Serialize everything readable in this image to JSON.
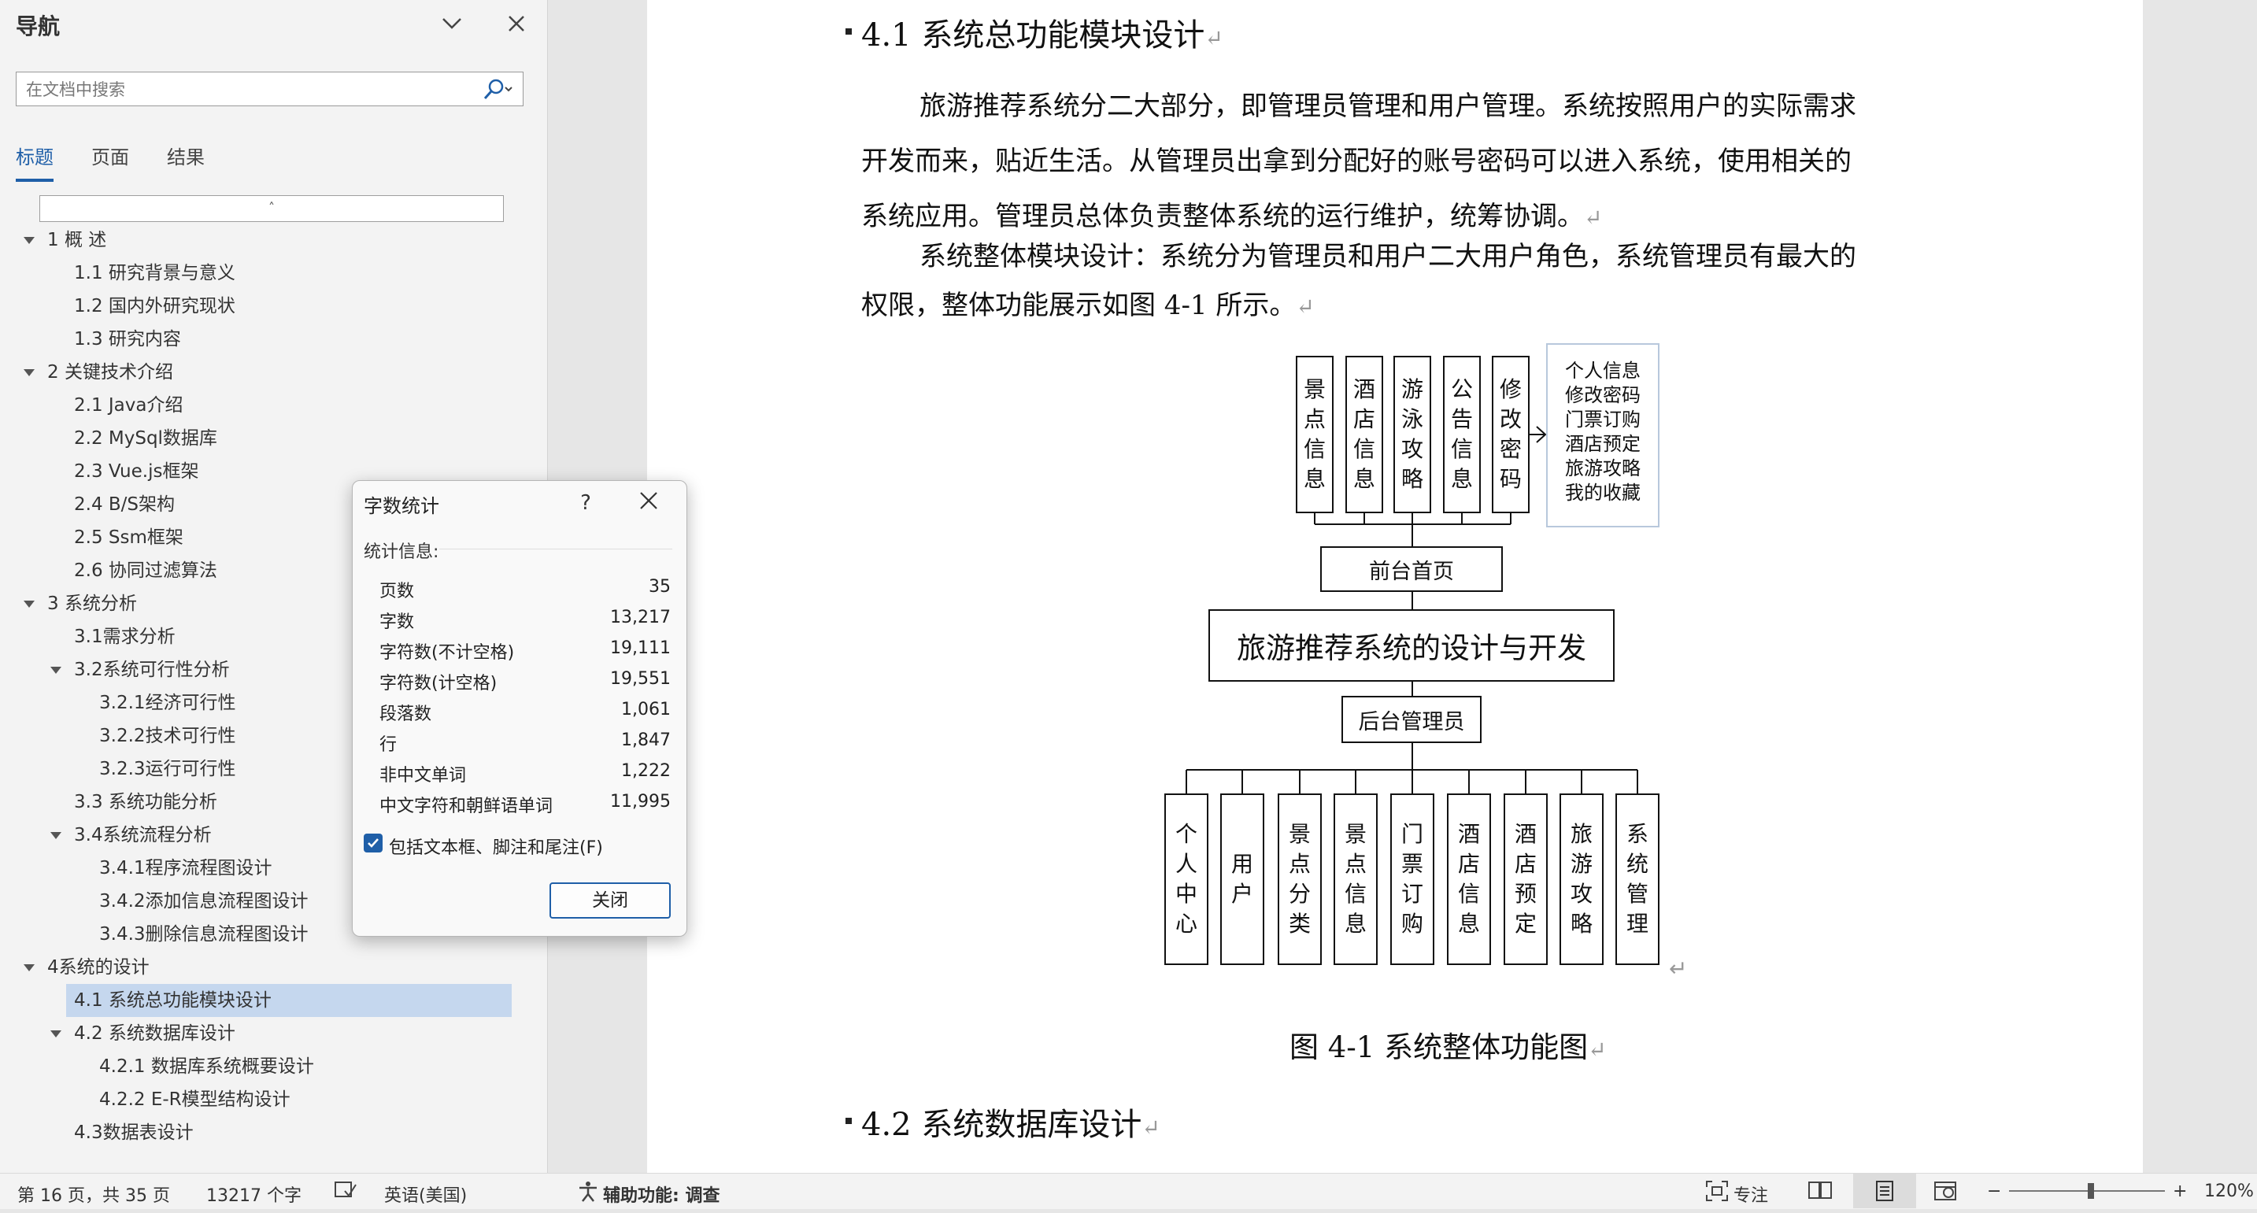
{
  "nav": {
    "title": "导航",
    "search_placeholder": "在文档中搜索",
    "tabs": [
      "标题",
      "页面",
      "结果"
    ],
    "collapse_glyph": "˄",
    "headings": [
      {
        "text": "1  概    述",
        "level": 1,
        "expand": true
      },
      {
        "text": "1.1 研究背景与意义",
        "level": 2
      },
      {
        "text": "1.2 国内外研究现状",
        "level": 2
      },
      {
        "text": "1.3 研究内容",
        "level": 2
      },
      {
        "text": "2  关键技术介绍",
        "level": 1,
        "expand": true
      },
      {
        "text": "2.1 Java介绍",
        "level": 2
      },
      {
        "text": "2.2 MySql数据库",
        "level": 2
      },
      {
        "text": "2.3 Vue.js框架",
        "level": 2
      },
      {
        "text": "2.4 B/S架构",
        "level": 2
      },
      {
        "text": "2.5 Ssm框架",
        "level": 2
      },
      {
        "text": "2.6 协同过滤算法",
        "level": 2
      },
      {
        "text": "3  系统分析",
        "level": 1,
        "expand": true
      },
      {
        "text": "3.1需求分析",
        "level": 2
      },
      {
        "text": "3.2系统可行性分析",
        "level": 2,
        "expand": true
      },
      {
        "text": "3.2.1经济可行性",
        "level": 3
      },
      {
        "text": "3.2.2技术可行性",
        "level": 3
      },
      {
        "text": "3.2.3运行可行性",
        "level": 3
      },
      {
        "text": "3.3 系统功能分析",
        "level": 2
      },
      {
        "text": "3.4系统流程分析",
        "level": 2,
        "expand": true
      },
      {
        "text": "3.4.1程序流程图设计",
        "level": 3
      },
      {
        "text": "3.4.2添加信息流程图设计",
        "level": 3
      },
      {
        "text": "3.4.3删除信息流程图设计",
        "level": 3
      },
      {
        "text": "4系统的设计",
        "level": 1,
        "expand": true
      },
      {
        "text": "4.1 系统总功能模块设计",
        "level": 2,
        "selected": true
      },
      {
        "text": "4.2 系统数据库设计",
        "level": 2,
        "expand": true
      },
      {
        "text": "4.2.1 数据库系统概要设计",
        "level": 3
      },
      {
        "text": "4.2.2 E-R模型结构设计",
        "level": 3
      },
      {
        "text": "4.3数据表设计",
        "level": 2
      }
    ]
  },
  "doc": {
    "heading1": "4.1  系统总功能模块设计",
    "para1_lines": [
      "旅游推荐系统分二大部分，即管理员管理和用户管理。系统按照用户的实际需求",
      "开发而来，贴近生活。从管理员出拿到分配好的账号密码可以进入系统，使用相关的",
      "系统应用。管理员总体负责整体系统的运行维护，统筹协调。"
    ],
    "para2_lines": [
      "系统整体模块设计：系统分为管理员和用户二大用户角色，系统管理员有最大的",
      "权限，整体功能展示如图 4-1 所示。"
    ],
    "paragraph_mark": "↵",
    "diagram": {
      "top_modules": [
        "景点信息",
        "酒店信息",
        "游泳攻略",
        "公告信息",
        "修改密码"
      ],
      "side_list": [
        "个人信息",
        "修改密码",
        "门票订购",
        "酒店预定",
        "旅游攻略",
        "我的收藏"
      ],
      "front_label": "前台首页",
      "root_label": "旅游推荐系统的设计与开发",
      "back_label": "后台管理员",
      "bottom_modules": [
        "个人中心",
        "用户",
        "景点分类",
        "景点信息",
        "门票订购",
        "酒店信息",
        "酒店预定",
        "旅游攻略",
        "系统管理"
      ]
    },
    "caption": "图 4-1  系统整体功能图",
    "heading2": "4.2  系统数据库设计"
  },
  "dialog": {
    "title": "字数统计",
    "help": "?",
    "section": "统计信息:",
    "stats": [
      {
        "label": "页数",
        "value": "35"
      },
      {
        "label": "字数",
        "value": "13,217"
      },
      {
        "label": "字符数(不计空格)",
        "value": "19,111"
      },
      {
        "label": "字符数(计空格)",
        "value": "19,551"
      },
      {
        "label": "段落数",
        "value": "1,061"
      },
      {
        "label": "行",
        "value": "1,847"
      },
      {
        "label": "非中文单词",
        "value": "1,222"
      },
      {
        "label": "中文字符和朝鲜语单词",
        "value": "11,995"
      }
    ],
    "checkbox_label": "包括文本框、脚注和尾注(F)",
    "checkbox_checked": true,
    "close_button": "关闭"
  },
  "status": {
    "page": "第 16 页，共 35 页",
    "words": "13217 个字",
    "language": "英语(美国)",
    "accessibility": "辅助功能: 调查",
    "focus": "专注",
    "zoom": "120%"
  },
  "colors": {
    "accent": "#1f5fa8",
    "selection": "#c5d7ee"
  }
}
